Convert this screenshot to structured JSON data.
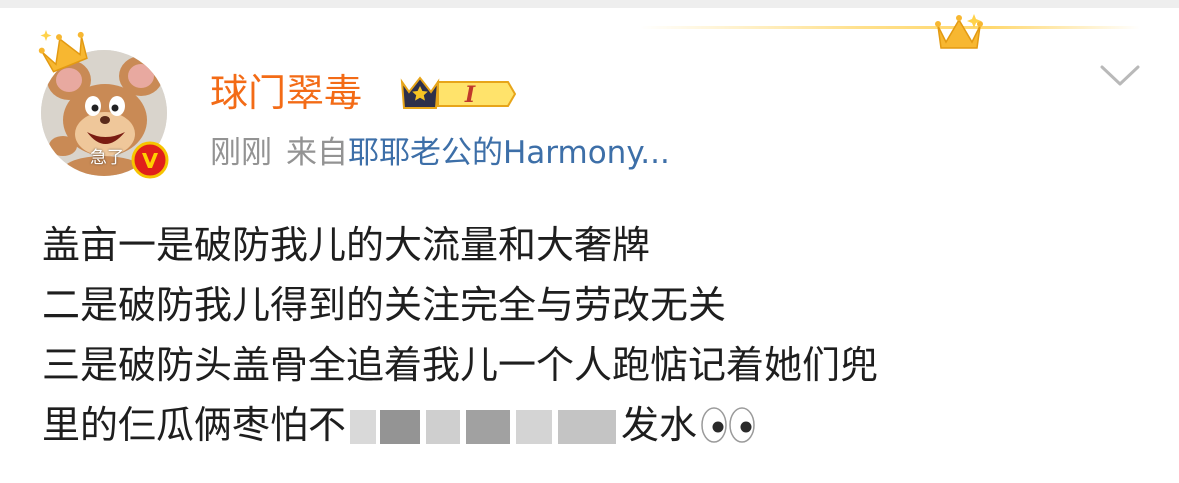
{
  "colors": {
    "username": "#f36b16",
    "meta_text": "#939393",
    "source_link": "#3d6fa8",
    "body_text": "#1e1e1e",
    "crown_gold": "#f7b731",
    "vip_red": "#e0201a"
  },
  "icons": {
    "avatar_crown": "crown-icon",
    "vip_badge": "vip-v-icon",
    "level_badge": "crown-level-icon",
    "more": "chevron-down-icon",
    "emoji": "eyes-emoji-icon"
  },
  "post": {
    "avatar_tag": "急了",
    "username": "球门翠毒",
    "level_label": "I",
    "time": "刚刚",
    "from_label": "来自",
    "source": "耶耶老公的Harmony...",
    "lines": [
      "盖亩一是破防我儿的大流量和大奢牌",
      "二是破防我儿得到的关注完全与劳改无关",
      "三是破防头盖骨全追着我儿一个人跑惦记着她们兜"
    ],
    "last_line_start": "里的仨瓜俩枣怕不",
    "last_line_end": "发水"
  }
}
